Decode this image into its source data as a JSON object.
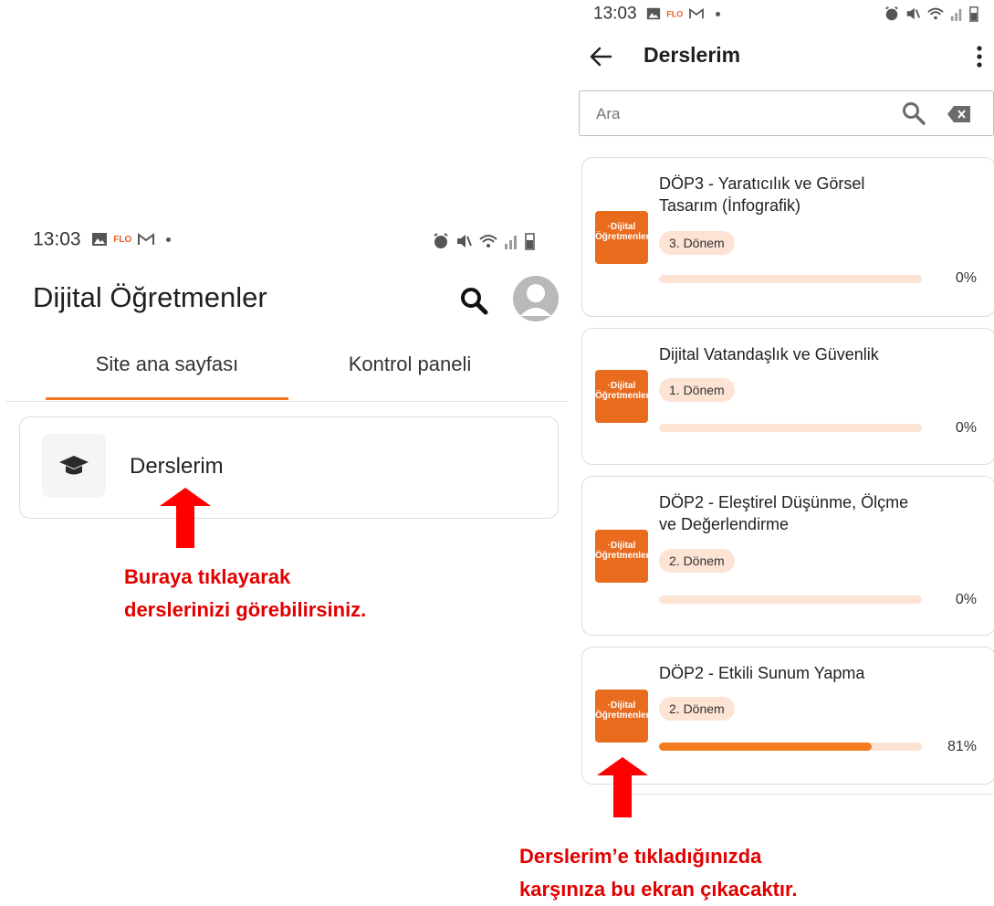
{
  "left_screen": {
    "status_bar": {
      "time": "13:03",
      "app_glyph": "FLO"
    },
    "app_title": "Dijital Öğretmenler",
    "tabs": [
      {
        "label": "Site ana sayfası",
        "active": true
      },
      {
        "label": "Kontrol paneli",
        "active": false
      }
    ],
    "menu_item": {
      "label": "Derslerim",
      "icon": "graduation-cap-icon"
    },
    "annotation": {
      "line1": "Buraya tıklayarak",
      "line2": "derslerinizi görebilirsiniz."
    }
  },
  "right_screen": {
    "status_bar": {
      "time": "13:03",
      "app_glyph": "FLO"
    },
    "header": {
      "title": "Derslerim"
    },
    "search": {
      "placeholder": "Ara"
    },
    "courses": [
      {
        "name_line1": "DÖP3 - Yaratıcılık ve Görsel",
        "name_line2": "Tasarım (İnfografik)",
        "term": "3. Dönem",
        "progress": 0,
        "progress_label": "0%",
        "thumb_label1": "·Dijital",
        "thumb_label2": "Öğretmenler"
      },
      {
        "name_line1": "Dijital Vatandaşlık ve Güvenlik",
        "name_line2": "",
        "term": "1. Dönem",
        "progress": 0,
        "progress_label": "0%",
        "thumb_label1": "·Dijital",
        "thumb_label2": "Öğretmenler"
      },
      {
        "name_line1": "DÖP2 - Eleştirel Düşünme, Ölçme",
        "name_line2": "ve Değerlendirme",
        "term": "2. Dönem",
        "progress": 0,
        "progress_label": "0%",
        "thumb_label1": "·Dijital",
        "thumb_label2": "Öğretmenler"
      },
      {
        "name_line1": "DÖP2 - Etkili Sunum Yapma",
        "name_line2": "",
        "term": "2. Dönem",
        "progress": 81,
        "progress_label": "81%",
        "thumb_label1": "·Dijital",
        "thumb_label2": "Öğretmenler"
      }
    ],
    "annotation": {
      "line1": "Derslerim’e tıkladığınızda",
      "line2": "karşınıza bu ekran çıkacaktır."
    }
  },
  "colors": {
    "accent": "#f47c20",
    "badge_bg": "#fde3d3",
    "annotation_red": "#e10000",
    "thumb_orange": "#e96b1d"
  }
}
